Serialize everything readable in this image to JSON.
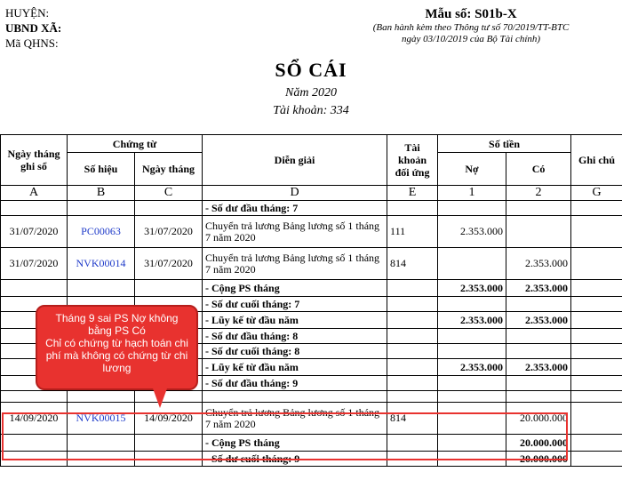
{
  "header": {
    "district": "HUYỆN:",
    "commune": "UBND XÃ:",
    "qhns": "Mã QHNS:",
    "form_no": "Mẫu số: S01b-X",
    "issued_line1": "(Ban hành kèm theo Thông tư số 70/2019/TT-BTC",
    "issued_line2": "ngày 03/10/2019 của Bộ Tài chính)"
  },
  "title": "SỔ CÁI",
  "year": "Năm 2020",
  "account": "Tài khoản: 334",
  "columns": {
    "date": "Ngày tháng ghi sổ",
    "voucher": "Chứng từ",
    "voucher_no": "Số hiệu",
    "voucher_date": "Ngày tháng",
    "description": "Diễn giải",
    "contra": "Tài khoản đối ứng",
    "amount": "Số tiền",
    "debit": "Nợ",
    "credit": "Có",
    "note": "Ghi chú"
  },
  "codes": [
    "A",
    "B",
    "C",
    "D",
    "E",
    "1",
    "2",
    "G"
  ],
  "rows": [
    {
      "date": "",
      "doc": "",
      "doc_date": "",
      "desc": "- Số dư đầu tháng: 7",
      "acct": "",
      "debit": "",
      "credit": "",
      "note": "",
      "bold": true
    },
    {
      "date": "31/07/2020",
      "doc": "PC00063",
      "doc_date": "31/07/2020",
      "desc": "Chuyển trả lương Bảng lương số 1 tháng 7 năm 2020",
      "acct": "111",
      "debit": "2.353.000",
      "credit": "",
      "note": "",
      "bold": false
    },
    {
      "date": "31/07/2020",
      "doc": "NVK00014",
      "doc_date": "31/07/2020",
      "desc": "Chuyển trả lương Bảng lương số 1 tháng 7 năm 2020",
      "acct": "814",
      "debit": "",
      "credit": "2.353.000",
      "note": "",
      "bold": false
    },
    {
      "date": "",
      "doc": "",
      "doc_date": "",
      "desc": "- Cộng PS tháng",
      "acct": "",
      "debit": "2.353.000",
      "credit": "2.353.000",
      "note": "",
      "bold": true
    },
    {
      "date": "",
      "doc": "",
      "doc_date": "",
      "desc": "- Số dư cuối tháng: 7",
      "acct": "",
      "debit": "",
      "credit": "",
      "note": "",
      "bold": true
    },
    {
      "date": "",
      "doc": "",
      "doc_date": "",
      "desc": "- Lũy kế từ đầu năm",
      "acct": "",
      "debit": "2.353.000",
      "credit": "2.353.000",
      "note": "",
      "bold": true
    },
    {
      "date": "",
      "doc": "",
      "doc_date": "",
      "desc": "- Số dư đầu tháng: 8",
      "acct": "",
      "debit": "",
      "credit": "",
      "note": "",
      "bold": true
    },
    {
      "date": "",
      "doc": "",
      "doc_date": "",
      "desc": "- Số dư cuối tháng: 8",
      "acct": "",
      "debit": "",
      "credit": "",
      "note": "",
      "bold": true
    },
    {
      "date": "",
      "doc": "",
      "doc_date": "",
      "desc": "- Lũy kế từ đầu năm",
      "acct": "",
      "debit": "2.353.000",
      "credit": "2.353.000",
      "note": "",
      "bold": true
    },
    {
      "date": "",
      "doc": "",
      "doc_date": "",
      "desc": "- Số dư đầu tháng: 9",
      "acct": "",
      "debit": "",
      "credit": "",
      "note": "",
      "bold": true
    },
    {
      "date": "",
      "doc": "",
      "doc_date": "",
      "desc": "",
      "acct": "",
      "debit": "",
      "credit": "",
      "note": "",
      "bold": false,
      "empty": true
    },
    {
      "date": "14/09/2020",
      "doc": "NVK00015",
      "doc_date": "14/09/2020",
      "desc": "Chuyển trả lương Bảng lương số 1 tháng 7 năm 2020",
      "acct": "814",
      "debit": "",
      "credit": "20.000.000",
      "note": "",
      "bold": false
    },
    {
      "date": "",
      "doc": "",
      "doc_date": "",
      "desc": "- Cộng PS tháng",
      "acct": "",
      "debit": "",
      "credit": "20.000.000",
      "note": "",
      "bold": true
    },
    {
      "date": "",
      "doc": "",
      "doc_date": "",
      "desc": "- Số dư cuối tháng: 9",
      "acct": "",
      "debit": "",
      "credit": "20.000.000",
      "note": "",
      "bold": true
    }
  ],
  "callout": {
    "line1": "Tháng 9 sai PS Nợ không bằng PS Có",
    "line2": "Chỉ có chứng từ hạch toán chi phí mà không có chứng từ chi lương",
    "color": "#e8322f"
  }
}
